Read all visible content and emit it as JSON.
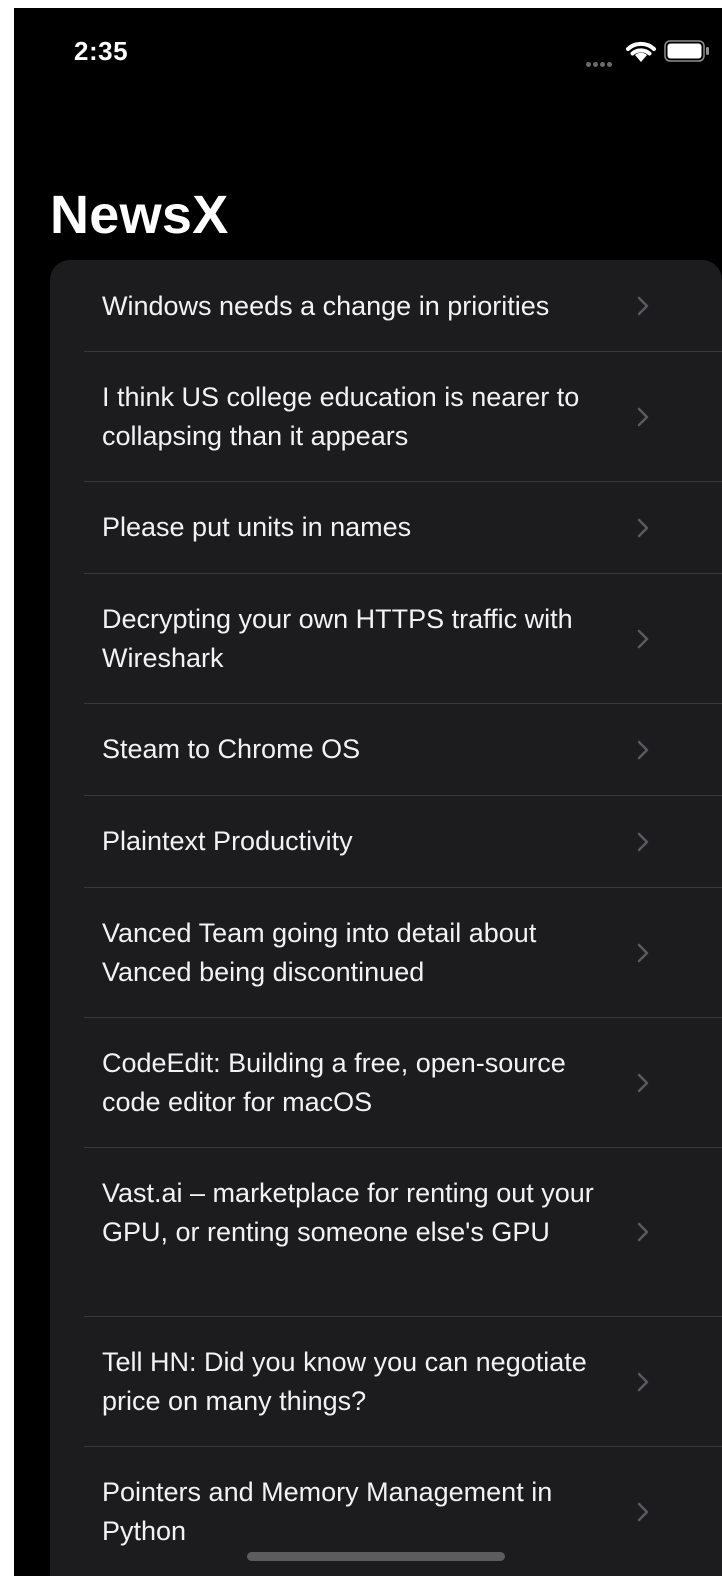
{
  "status_bar": {
    "time": "2:35"
  },
  "nav": {
    "title": "NewsX"
  },
  "icons": {
    "row_accessory": "chevron-right-icon",
    "wifi": "wifi-icon",
    "battery": "battery-icon"
  },
  "colors": {
    "background": "#000000",
    "card": "#1c1c1e",
    "separator": "#38383a",
    "text": "#f2f2f2",
    "chevron": "#5a5a5e"
  },
  "list": {
    "items": [
      {
        "title": "Windows needs a change in priorities"
      },
      {
        "title": "I think US college education is nearer to collapsing than it appears"
      },
      {
        "title": "Please put units in names"
      },
      {
        "title": "Decrypting your own HTTPS traffic with Wireshark"
      },
      {
        "title": "Steam to Chrome OS"
      },
      {
        "title": "Plaintext Productivity"
      },
      {
        "title": "Vanced Team going into detail about Vanced being discontinued"
      },
      {
        "title": "CodeEdit: Building a free, open-source code editor for macOS"
      },
      {
        "title": "Vast.ai – marketplace for renting out your GPU, or renting someone else's GPU"
      },
      {
        "title": "Tell HN: Did you know you can negotiate price on many things?"
      },
      {
        "title": "Pointers and Memory Management in Python"
      }
    ]
  }
}
